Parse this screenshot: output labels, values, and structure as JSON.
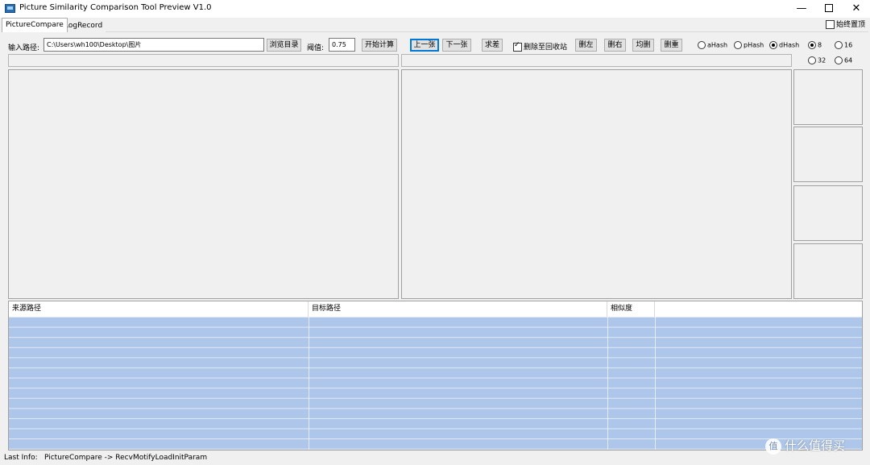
{
  "window": {
    "title": "Picture Similarity Comparison Tool Preview V1.0",
    "minimize": "—",
    "maximize": "",
    "close": "✕"
  },
  "tabs": [
    {
      "label": "PictureCompare",
      "active": true
    },
    {
      "label": "LogRecord",
      "active": false
    }
  ],
  "topmost": {
    "label": "始终置顶",
    "checked": false
  },
  "controls": {
    "path_label": "输入路径:",
    "path_value": "C:\\Users\\wh100\\Desktop\\图片",
    "browse_label": "浏览目录",
    "threshold_label": "阈值:",
    "threshold_value": "0.75",
    "start_label": "开始计算",
    "prev_label": "上一张",
    "next_label": "下一张",
    "diff_label": "求差",
    "recycle_label": "删除至回收站",
    "recycle_checked": true,
    "del_left_label": "删左",
    "del_right_label": "删右",
    "del_both_label": "均删",
    "del_dup_label": "删重"
  },
  "hash_options": [
    {
      "label": "aHash",
      "selected": false
    },
    {
      "label": "pHash",
      "selected": false
    },
    {
      "label": "dHash",
      "selected": true
    }
  ],
  "size_options": [
    {
      "label": "8",
      "selected": true
    },
    {
      "label": "16",
      "selected": false
    },
    {
      "label": "32",
      "selected": false
    },
    {
      "label": "64",
      "selected": false
    }
  ],
  "table": {
    "columns": [
      "来源路径",
      "目标路径",
      "相似度",
      ""
    ]
  },
  "status": {
    "label": "Last Info:",
    "value": "PictureCompare -> RecvMotifyLoadInitParam"
  },
  "watermark": {
    "icon": "值",
    "text": "什么值得买"
  }
}
